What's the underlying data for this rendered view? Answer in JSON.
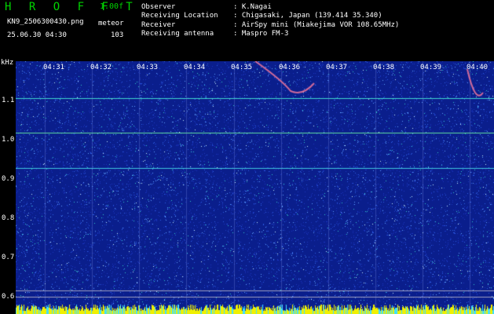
{
  "header": {
    "brand": "H R O F F T",
    "version": "1.00f",
    "file_name": "KN9_2506300430.png",
    "kind": "meteor",
    "datetime": "25.06.30 04:30",
    "count": "103"
  },
  "info": [
    {
      "label": "Observer",
      "value": ": K.Nagai"
    },
    {
      "label": "Receiving Location",
      "value": ": Chigasaki, Japan (139.414 35.340)"
    },
    {
      "label": "Receiver",
      "value": ": AirSpy mini (Miakejima VOR 108.65MHz)"
    },
    {
      "label": "Receiving antenna",
      "value": ": Maspro FM-3"
    }
  ],
  "axis": {
    "y_unit": "kHz",
    "y_ticks": [
      "1.1",
      "1.0",
      "0.9",
      "0.8",
      "0.7",
      "0.6"
    ],
    "time_ticks": [
      "04:31",
      "04:32",
      "04:33",
      "04:34",
      "04:35",
      "04:36",
      "04:37",
      "04:38",
      "04:39",
      "04:40"
    ]
  },
  "colors": {
    "background": "#000000",
    "spectrum_base": "#0a1e8c",
    "brand_green": "#00d400",
    "label_white": "#ffffff"
  }
}
